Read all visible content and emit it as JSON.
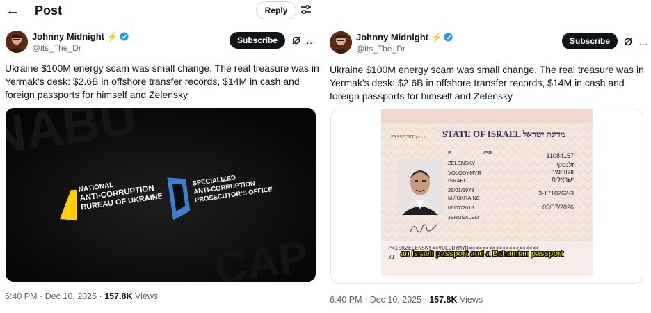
{
  "topbar": {
    "title": "Post",
    "reply_label": "Reply"
  },
  "author": {
    "name": "Johnny Midnight",
    "badge_emoji": "⚡",
    "handle": "@its_The_Dr",
    "subscribe_label": "Subscribe"
  },
  "tweet": {
    "lines": [
      "Ukraine $100M energy scam was small change. The real treasure was in",
      "Yermak's desk: $2.6B in offshore transfer records, $14M in cash and",
      "foreign passports for himself and Zelensky"
    ]
  },
  "logos": {
    "nabu_line1": "NATIONAL",
    "nabu_line2": "ANTI-CORRUPTION",
    "nabu_line3": "BUREAU OF UKRAINE",
    "sapo_line1": "SPECIALIZED",
    "sapo_line2": "ANTI-CORRUPTION",
    "sapo_line3": "PROSECUTOR'S OFFICE"
  },
  "passport": {
    "header_left": "PASSPORT",
    "header_left_he": "דרכון",
    "state": "STATE OF ISRAEL",
    "state_he": "מדינת ישראל",
    "number": "31084157",
    "code": "ISR",
    "type": "P",
    "surname": "ZELENSKY",
    "given": "VOLODYMYR",
    "nationality": "ISRAELI",
    "dob": "25/01/1978",
    "sex": "M / UKRAINE",
    "issue": "06/07/2016",
    "expiry": "05/07/2026",
    "authority": "JERUSALEM",
    "id_no": "3-1710262-3",
    "surname_he": "זלנסקי",
    "given_he": "וולודימיר",
    "nationality_he": "ישראלית",
    "mrz": "P<ISRZELENSKY<<VOLODYMYR<<<<<<<<<<<<<<<<<<<<<",
    "mrz2": "31",
    "caption": "an Israeli passport and a Bahamian passport"
  },
  "footer": {
    "time": "6:40 PM",
    "sep": "·",
    "date": "Dec 10, 2025",
    "views": "157.8K",
    "views_label": "Views"
  },
  "colors": {
    "verified": "#1d9bf0",
    "nabu_yellow": "#ffd000",
    "sapo_blue": "#3a7fd0",
    "caption_yellow": "#f7f200"
  }
}
